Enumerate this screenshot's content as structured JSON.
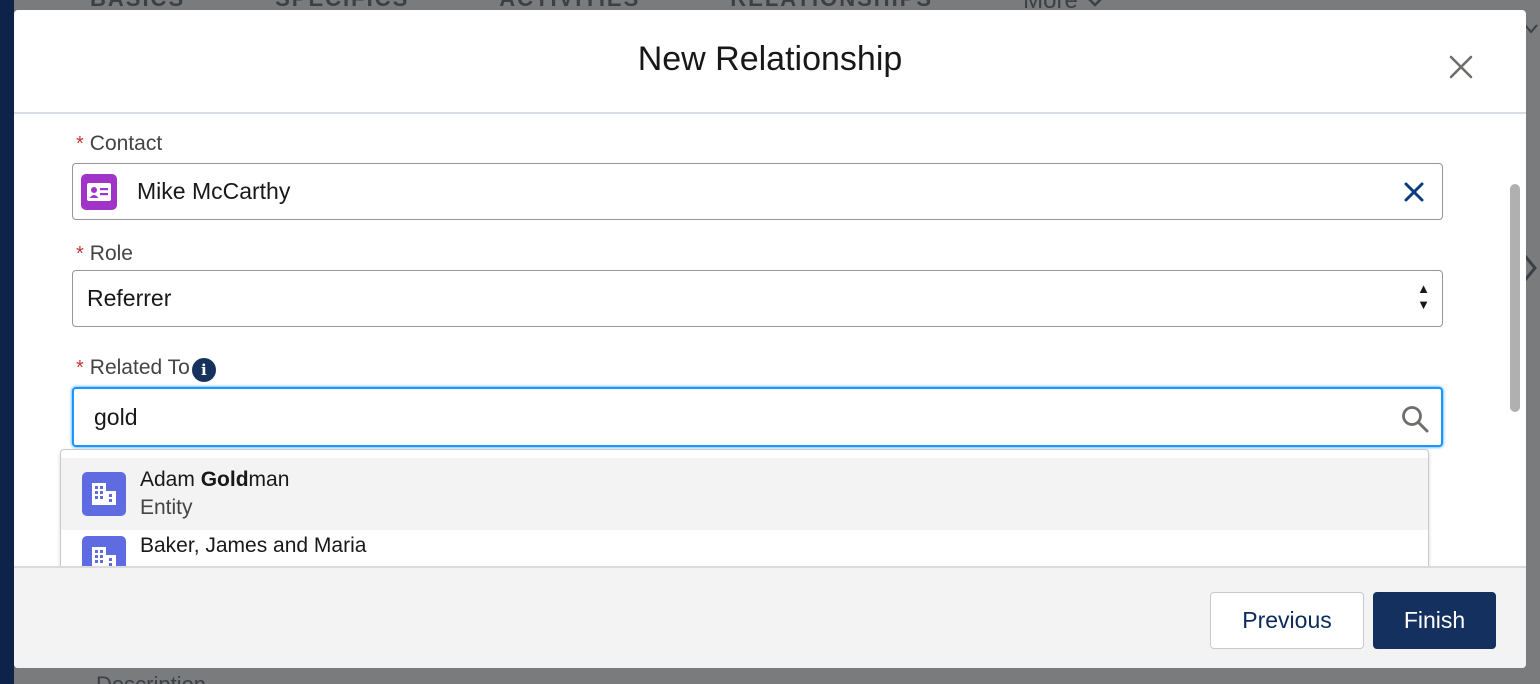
{
  "background": {
    "tabs": [
      "BASICS",
      "SPECIFICS",
      "ACTIVITIES",
      "RELATIONSHIPS"
    ],
    "more_label": "More",
    "bottom_text": "Description"
  },
  "modal": {
    "title": "New Relationship",
    "close_icon": "close-icon"
  },
  "fields": {
    "contact": {
      "label": "Contact",
      "required": "*",
      "value": "Mike McCarthy",
      "icon": "contact-card-icon",
      "icon_color": "#a033c8"
    },
    "role": {
      "label": "Role",
      "required": "*",
      "value": "Referrer"
    },
    "related_to": {
      "label": "Related To",
      "required": "*",
      "value": "gold",
      "info_icon": "i"
    }
  },
  "dropdown": {
    "options": [
      {
        "prefix": "Adam ",
        "match": "Gold",
        "suffix": "man",
        "subtitle": "Entity",
        "icon": "building-icon"
      },
      {
        "prefix": "Baker, James and Maria",
        "match": "",
        "suffix": "",
        "subtitle": "",
        "icon": "building-icon"
      }
    ],
    "icon_color": "#5f6be0"
  },
  "footer": {
    "previous_label": "Previous",
    "finish_label": "Finish"
  },
  "colors": {
    "required": "#c23934",
    "brand_navy": "#14305f",
    "focus_blue": "#1b96ff"
  }
}
